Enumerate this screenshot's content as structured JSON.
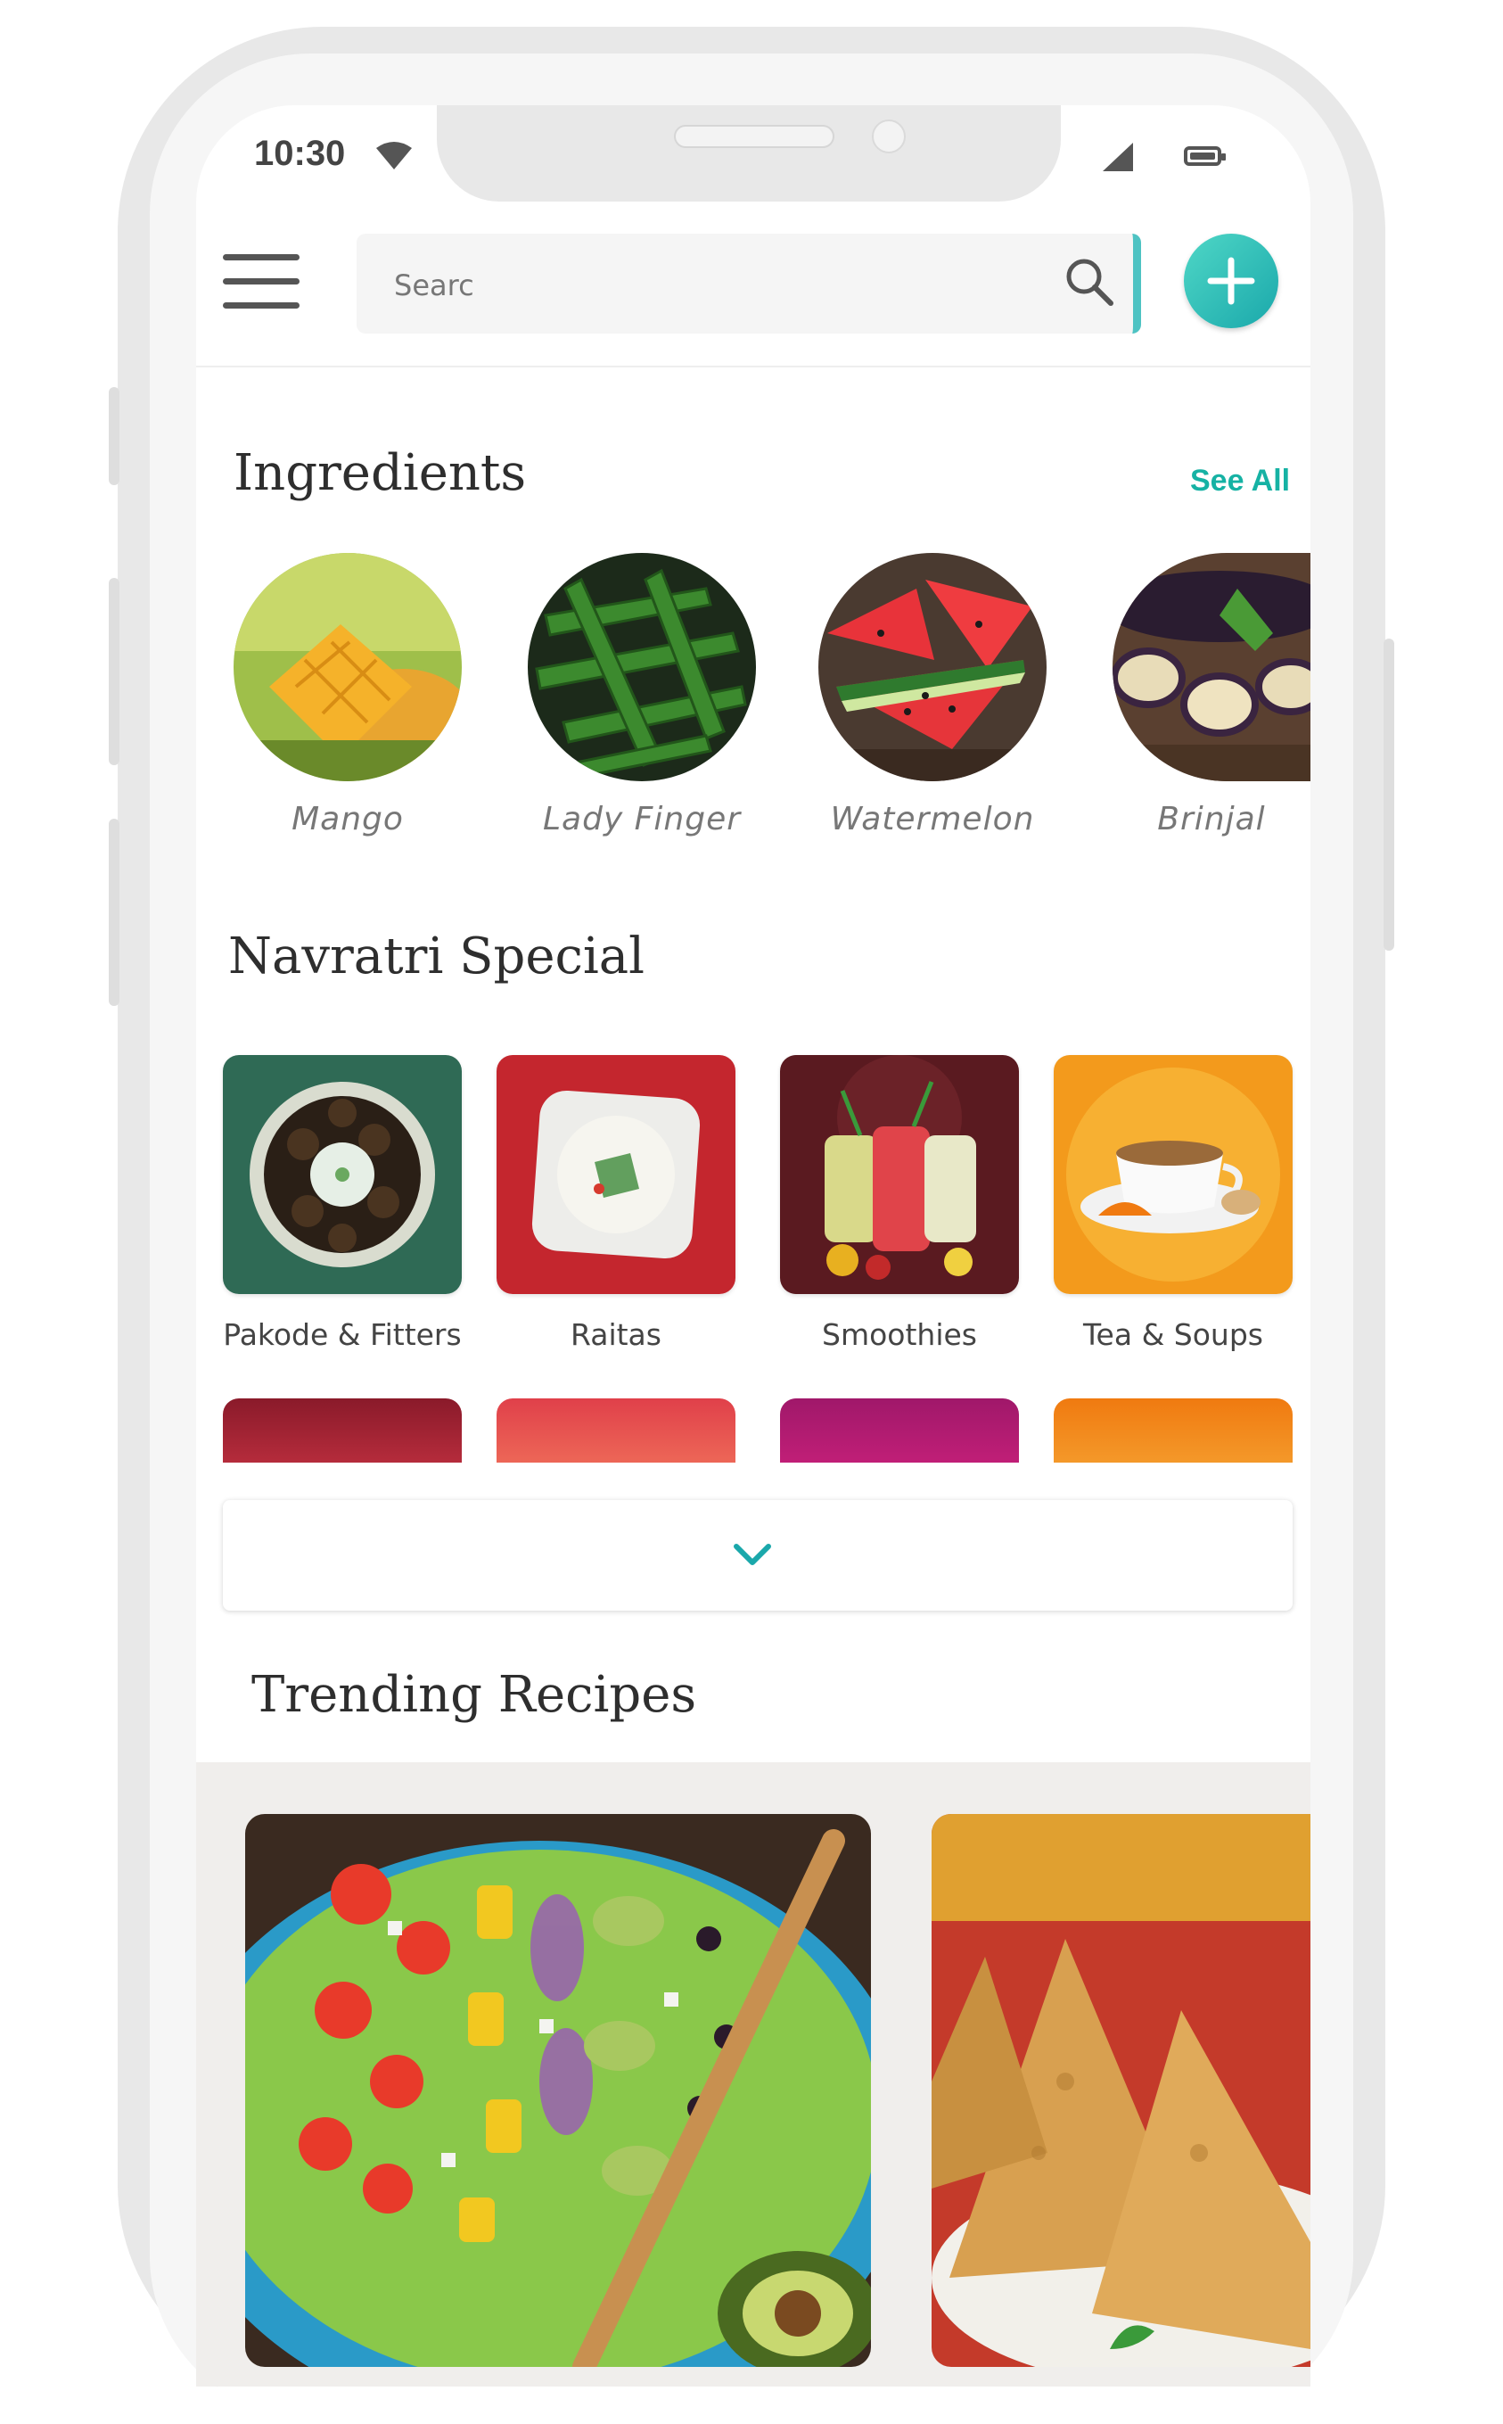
{
  "status_bar": {
    "time": "10:30"
  },
  "search": {
    "placeholder": "",
    "value": "Searc"
  },
  "ingredients": {
    "title": "Ingredients",
    "see_all": "See All",
    "items": [
      {
        "label": "Mango",
        "icon": "mango-photo"
      },
      {
        "label": "Lady  Finger",
        "icon": "okra-photo"
      },
      {
        "label": "Watermelon",
        "icon": "watermelon-photo"
      },
      {
        "label": "Brinjal",
        "icon": "brinjal-photo"
      }
    ]
  },
  "navratri": {
    "title": "Navratri Special",
    "items": [
      {
        "label": "Pakode & Fitters",
        "icon": "pakode-photo"
      },
      {
        "label": "Raitas",
        "icon": "raita-photo"
      },
      {
        "label": "Smoothies",
        "icon": "smoothie-photo"
      },
      {
        "label": "Tea & Soups",
        "icon": "tea-photo"
      }
    ]
  },
  "trending": {
    "title": "Trending Recipes",
    "items": [
      {
        "icon": "salad-photo"
      },
      {
        "icon": "samosa-photo"
      }
    ]
  },
  "colors": {
    "accent": "#16b2a4",
    "add_button": "#1aa8ab",
    "search_border": "#4ec3c3"
  }
}
